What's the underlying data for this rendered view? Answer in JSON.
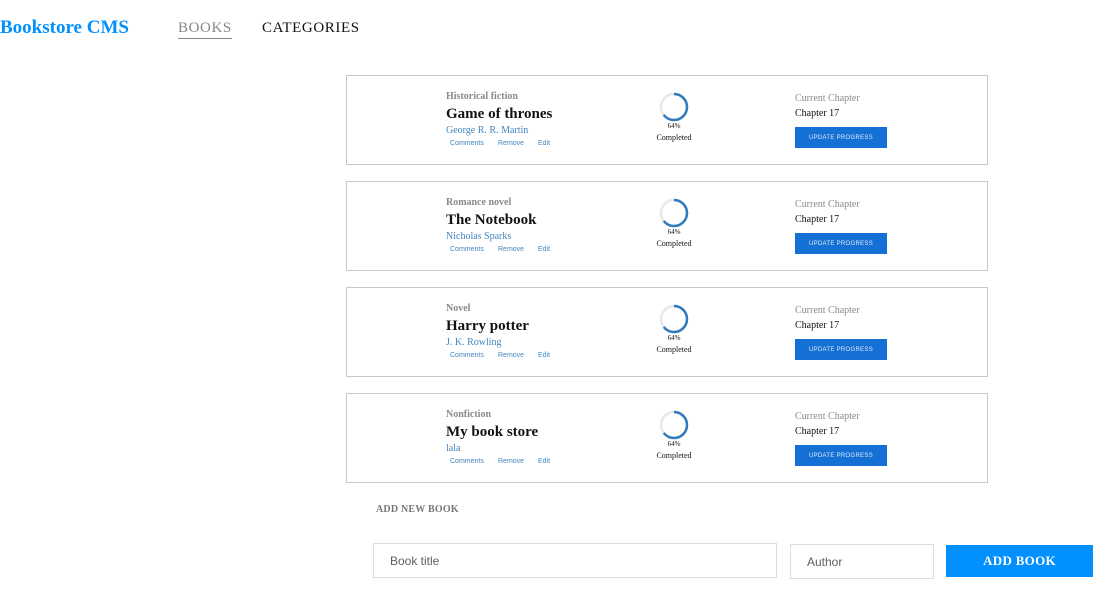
{
  "header": {
    "brand": "Bookstore CMS",
    "nav": {
      "books": "BOOKS",
      "categories": "CATEGORIES"
    }
  },
  "books": [
    {
      "category": "Historical fiction",
      "title": "Game of thrones",
      "author": "George R. R. Martin",
      "actions": {
        "comments": "Comments",
        "remove": "Remove",
        "edit": "Edit"
      },
      "progress_percent": 64,
      "progress_label": "64%",
      "completed_label": "Completed",
      "current_chapter_label": "Current Chapter",
      "current_chapter": "Chapter 17",
      "update_button": "UPDATE PROGRESS"
    },
    {
      "category": "Romance novel",
      "title": "The Notebook",
      "author": "Nicholas Sparks",
      "actions": {
        "comments": "Comments",
        "remove": "Remove",
        "edit": "Edit"
      },
      "progress_percent": 64,
      "progress_label": "64%",
      "completed_label": "Completed",
      "current_chapter_label": "Current Chapter",
      "current_chapter": "Chapter 17",
      "update_button": "UPDATE PROGRESS"
    },
    {
      "category": "Novel",
      "title": "Harry potter",
      "author": "J. K. Rowling",
      "actions": {
        "comments": "Comments",
        "remove": "Remove",
        "edit": "Edit"
      },
      "progress_percent": 64,
      "progress_label": "64%",
      "completed_label": "Completed",
      "current_chapter_label": "Current Chapter",
      "current_chapter": "Chapter 17",
      "update_button": "UPDATE PROGRESS"
    },
    {
      "category": "Nonfiction",
      "title": "My book store",
      "author": "lala",
      "actions": {
        "comments": "Comments",
        "remove": "Remove",
        "edit": "Edit"
      },
      "progress_percent": 64,
      "progress_label": "64%",
      "completed_label": "Completed",
      "current_chapter_label": "Current Chapter",
      "current_chapter": "Chapter 17",
      "update_button": "UPDATE PROGRESS"
    }
  ],
  "add_form": {
    "heading": "ADD NEW BOOK",
    "title_placeholder": "Book title",
    "author_placeholder": "Author",
    "submit_label": "ADD BOOK"
  },
  "colors": {
    "brand": "#0290ff",
    "progress_ring": "#307bbe",
    "progress_track": "#e8e8e8",
    "update_button_bg": "#1570d6",
    "add_button_bg": "#0290ff"
  }
}
